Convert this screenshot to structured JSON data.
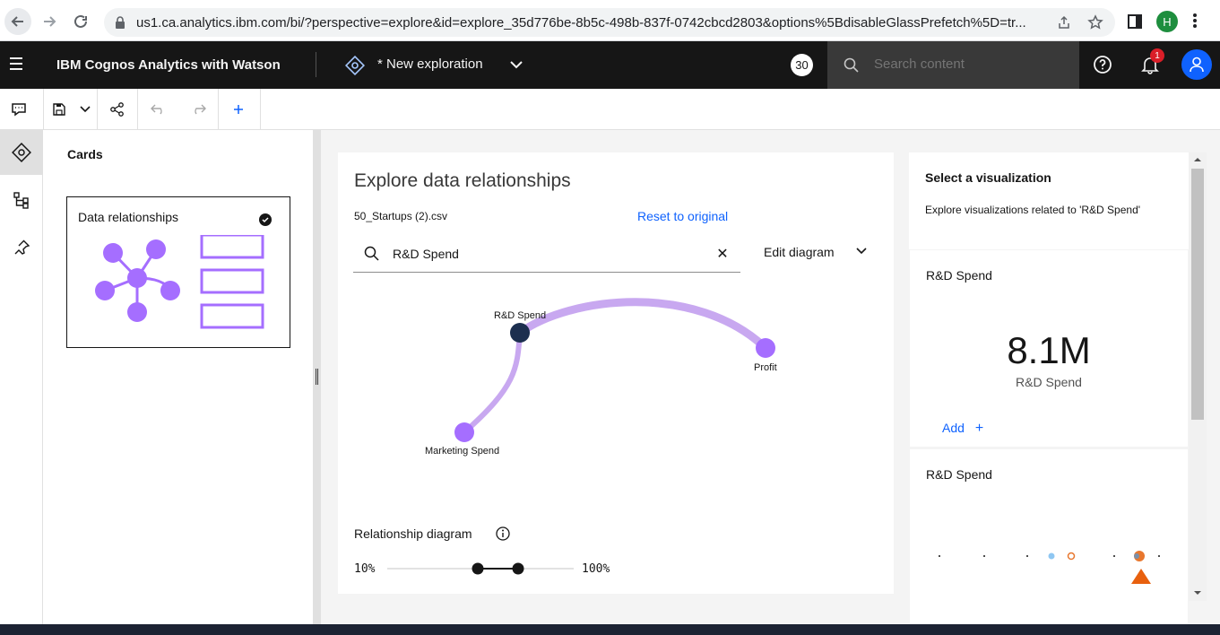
{
  "browser": {
    "url": "us1.ca.analytics.ibm.com/bi/?perspective=explore&id=explore_35d776be-8b5c-498b-837f-0742cbcd2803&options%5BdisableGlassPrefetch%5D=tr...",
    "profile_initial": "H"
  },
  "header": {
    "product": "IBM Cognos Analytics with Watson",
    "exploration_title": "* New exploration",
    "count_badge": "30",
    "search_placeholder": "Search content",
    "notification_count": "1"
  },
  "cards_panel": {
    "title": "Cards",
    "card_label": "Data relationships"
  },
  "explore": {
    "title": "Explore data relationships",
    "dataset": "50_Startups (2).csv",
    "reset_label": "Reset to original",
    "search_value": "R&D Spend",
    "edit_diagram_label": "Edit diagram",
    "nodes": {
      "center": "R&D Spend",
      "right": "Profit",
      "left": "Marketing Spend"
    },
    "relationship_label": "Relationship diagram",
    "slider_min_label": "10%",
    "slider_max_label": "100%"
  },
  "viz_panel": {
    "title": "Select a visualization",
    "description": "Explore visualizations related to 'R&D Spend'",
    "kpi_card": {
      "title": "R&D Spend",
      "value": "8.1M",
      "label": "R&D Spend",
      "add_label": "Add"
    },
    "second_card": {
      "title": "R&D Spend"
    }
  },
  "colors": {
    "header_bg": "#161616",
    "accent_blue": "#0f62fe",
    "purple": "#a56eff",
    "light_purple": "#c8a8f0",
    "node_dark": "#1c2f4f"
  }
}
